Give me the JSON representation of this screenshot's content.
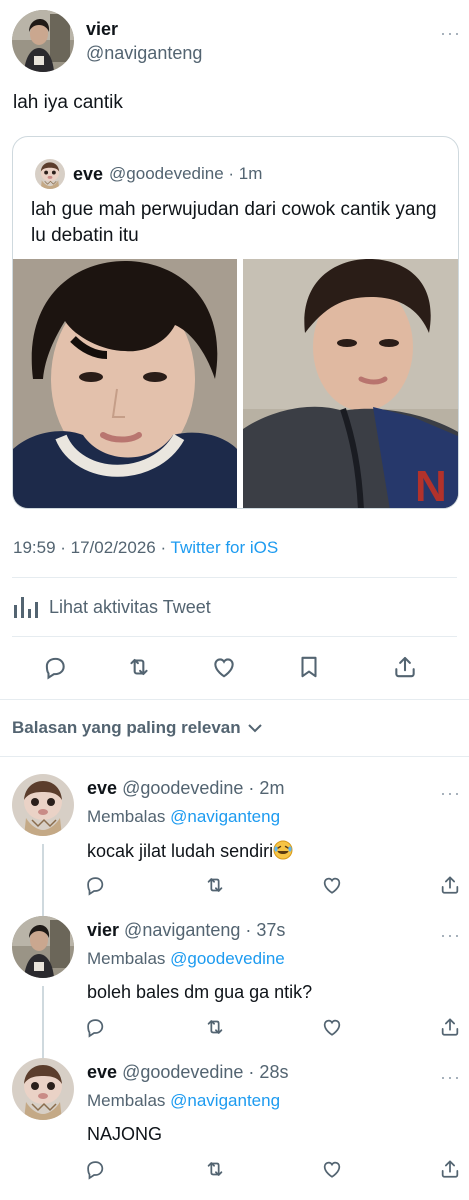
{
  "main_tweet": {
    "name": "vier",
    "handle": "@naviganteng",
    "text": "lah iya cantik",
    "more_glyph": "···"
  },
  "quote": {
    "name": "eve",
    "handle_time": "@goodevedine · 1m",
    "text": "lah gue mah perwujudan dari cowok cantik yang lu debatin itu"
  },
  "meta": {
    "datetime": "19:59 · 17/02/2026 · ",
    "source": "Twitter for iOS"
  },
  "activity": {
    "label": "Lihat aktivitas Tweet"
  },
  "sort": {
    "label": "Balasan yang paling relevan"
  },
  "replies": [
    {
      "name": "eve",
      "handle_time": "@goodevedine · 2m",
      "replying_prefix": "Membalas ",
      "replying_to": "@naviganteng",
      "text": "kocak jilat ludah sendiri",
      "more_glyph": "···"
    },
    {
      "name": "vier",
      "handle_time": "@naviganteng · 37s",
      "replying_prefix": "Membalas ",
      "replying_to": "@goodevedine",
      "text": "boleh bales dm gua ga ntik?",
      "more_glyph": "···"
    },
    {
      "name": "eve",
      "handle_time": "@goodevedine · 28s",
      "replying_prefix": "Membalas ",
      "replying_to": "@naviganteng",
      "text": "NAJONG",
      "more_glyph": "···"
    }
  ],
  "icons": [
    "reply-icon",
    "retweet-icon",
    "like-icon",
    "bookmark-icon",
    "share-icon",
    "chart-icon",
    "chevron-down-icon",
    "laughing-emoji"
  ],
  "colors": {
    "link": "#1d9bf0",
    "secondary_text": "#536471",
    "primary_text": "#0f1419",
    "divider": "#e6ecf0"
  }
}
